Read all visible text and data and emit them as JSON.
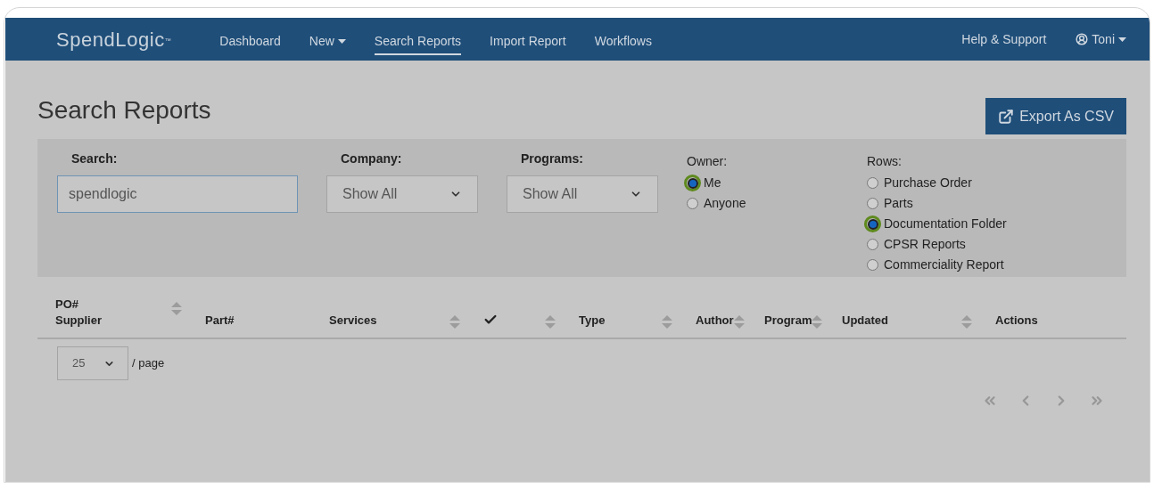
{
  "navbar": {
    "logo": "SpendLogic",
    "logo_mark": "™",
    "links": [
      {
        "label": "Dashboard",
        "selected": false,
        "dropdown": false
      },
      {
        "label": "New",
        "selected": false,
        "dropdown": true
      },
      {
        "label": "Search Reports",
        "selected": true,
        "dropdown": false
      },
      {
        "label": "Import Report",
        "selected": false,
        "dropdown": false
      },
      {
        "label": "Workflows",
        "selected": false,
        "dropdown": false
      }
    ],
    "help": "Help & Support",
    "user": "Toni"
  },
  "page_title": "Search Reports",
  "export_button": "Export As CSV",
  "filters": {
    "search": {
      "label": "Search:",
      "value": "spendlogic"
    },
    "company": {
      "label": "Company:",
      "value": "Show All"
    },
    "programs": {
      "label": "Programs:",
      "value": "Show All"
    },
    "owner": {
      "label": "Owner:",
      "options": [
        {
          "label": "Me",
          "selected": true
        },
        {
          "label": "Anyone",
          "selected": false
        }
      ]
    },
    "rows": {
      "label": "Rows:",
      "options": [
        {
          "label": "Purchase Order",
          "selected": false
        },
        {
          "label": "Parts",
          "selected": false
        },
        {
          "label": "Documentation Folder",
          "selected": true
        },
        {
          "label": "CPSR Reports",
          "selected": false
        },
        {
          "label": "Commerciality Report",
          "selected": false
        }
      ]
    }
  },
  "table": {
    "columns": [
      {
        "kind": "text",
        "lines": [
          "PO#",
          "Supplier"
        ],
        "sortable": true
      },
      {
        "kind": "text",
        "lines": [
          "Part#"
        ],
        "sortable": false
      },
      {
        "kind": "text",
        "lines": [
          "Services"
        ],
        "sortable": true
      },
      {
        "kind": "check",
        "sortable": true
      },
      {
        "kind": "text",
        "lines": [
          "Type"
        ],
        "sortable": true
      },
      {
        "kind": "text",
        "lines": [
          "Author"
        ],
        "sortable": true
      },
      {
        "kind": "text",
        "lines": [
          "Program"
        ],
        "sortable": true
      },
      {
        "kind": "text",
        "lines": [
          "Updated"
        ],
        "sortable": true
      },
      {
        "kind": "text",
        "lines": [
          "Actions"
        ],
        "sortable": false
      }
    ]
  },
  "page_size": {
    "value": "25",
    "suffix": "/ page"
  }
}
